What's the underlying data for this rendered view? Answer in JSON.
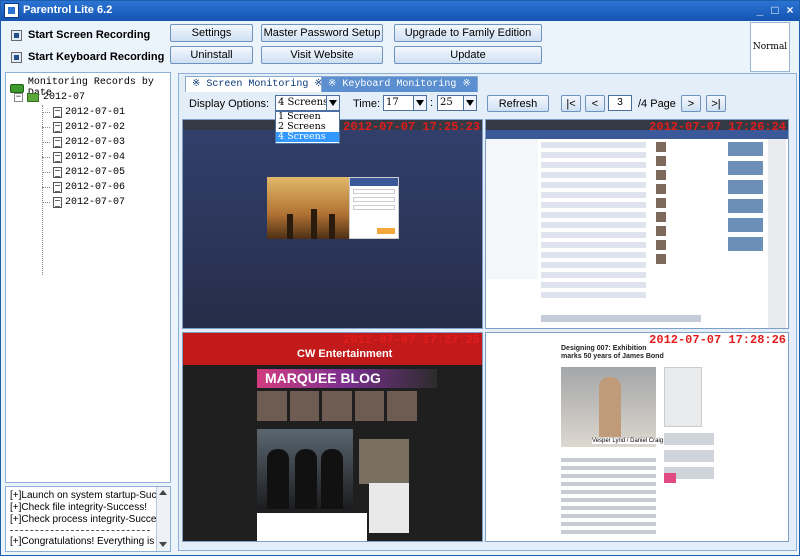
{
  "window": {
    "title": "Parentrol Lite 6.2",
    "controls": [
      "_",
      "□",
      "×"
    ]
  },
  "recording": {
    "screen_label": "Start Screen Recording",
    "keyboard_label": "Start Keyboard Recording"
  },
  "toolbar": {
    "settings": "Settings",
    "master_password": "Master Password Setup",
    "upgrade": "Upgrade to Family Edition",
    "uninstall": "Uninstall",
    "visit_website": "Visit Website",
    "update": "Update"
  },
  "status_mode": "Normal",
  "tree": {
    "root": "Monitoring Records by Date",
    "month": "2012-07",
    "days": [
      "2012-07-01",
      "2012-07-02",
      "2012-07-03",
      "2012-07-04",
      "2012-07-05",
      "2012-07-06",
      "2012-07-07"
    ]
  },
  "log": {
    "lines": [
      "[+]Launch on system startup-Success!",
      "[+]Check file integrity-Success!",
      "[+]Check process integrity-Success!"
    ],
    "final": "[+]Congratulations! Everything is ready."
  },
  "tabs": [
    {
      "label": "※ Screen Monitoring ※",
      "active": true
    },
    {
      "label": "※ Keyboard Monitoring ※",
      "active": false
    }
  ],
  "controls": {
    "display_label": "Display Options:",
    "display_value": "4 Screens",
    "display_options": [
      "1 Screen",
      "2 Screens",
      "4 Screens"
    ],
    "time_label": "Time:",
    "hour": "17",
    "minute": "25",
    "time_sep": ":",
    "refresh": "Refresh",
    "first": "|<",
    "prev": "<",
    "page": "3",
    "page_total": "/4 Page",
    "next": ">",
    "last": ">|"
  },
  "screens": [
    {
      "timestamp": "2012-07-07 17:25:23"
    },
    {
      "timestamp": "2012-07-07 17:26:24"
    },
    {
      "timestamp": "2012-07-07 17:27:25"
    },
    {
      "timestamp": "2012-07-07 17:28:26"
    }
  ],
  "screen_content": {
    "entertainment_logo": "CW Entertainment",
    "marquee_text": "MARQUEE BLOG",
    "bond_headline": "Designing 007: Exhibition marks 50 years of James Bond",
    "bond_caption": "Vesper Lynd / Daniel Craig"
  },
  "colors": {
    "title_bar": "#1a5fc4",
    "stamp": "#e21c1c",
    "tab_active": "#ffffff",
    "tab_inactive": "#5b8fd0"
  }
}
